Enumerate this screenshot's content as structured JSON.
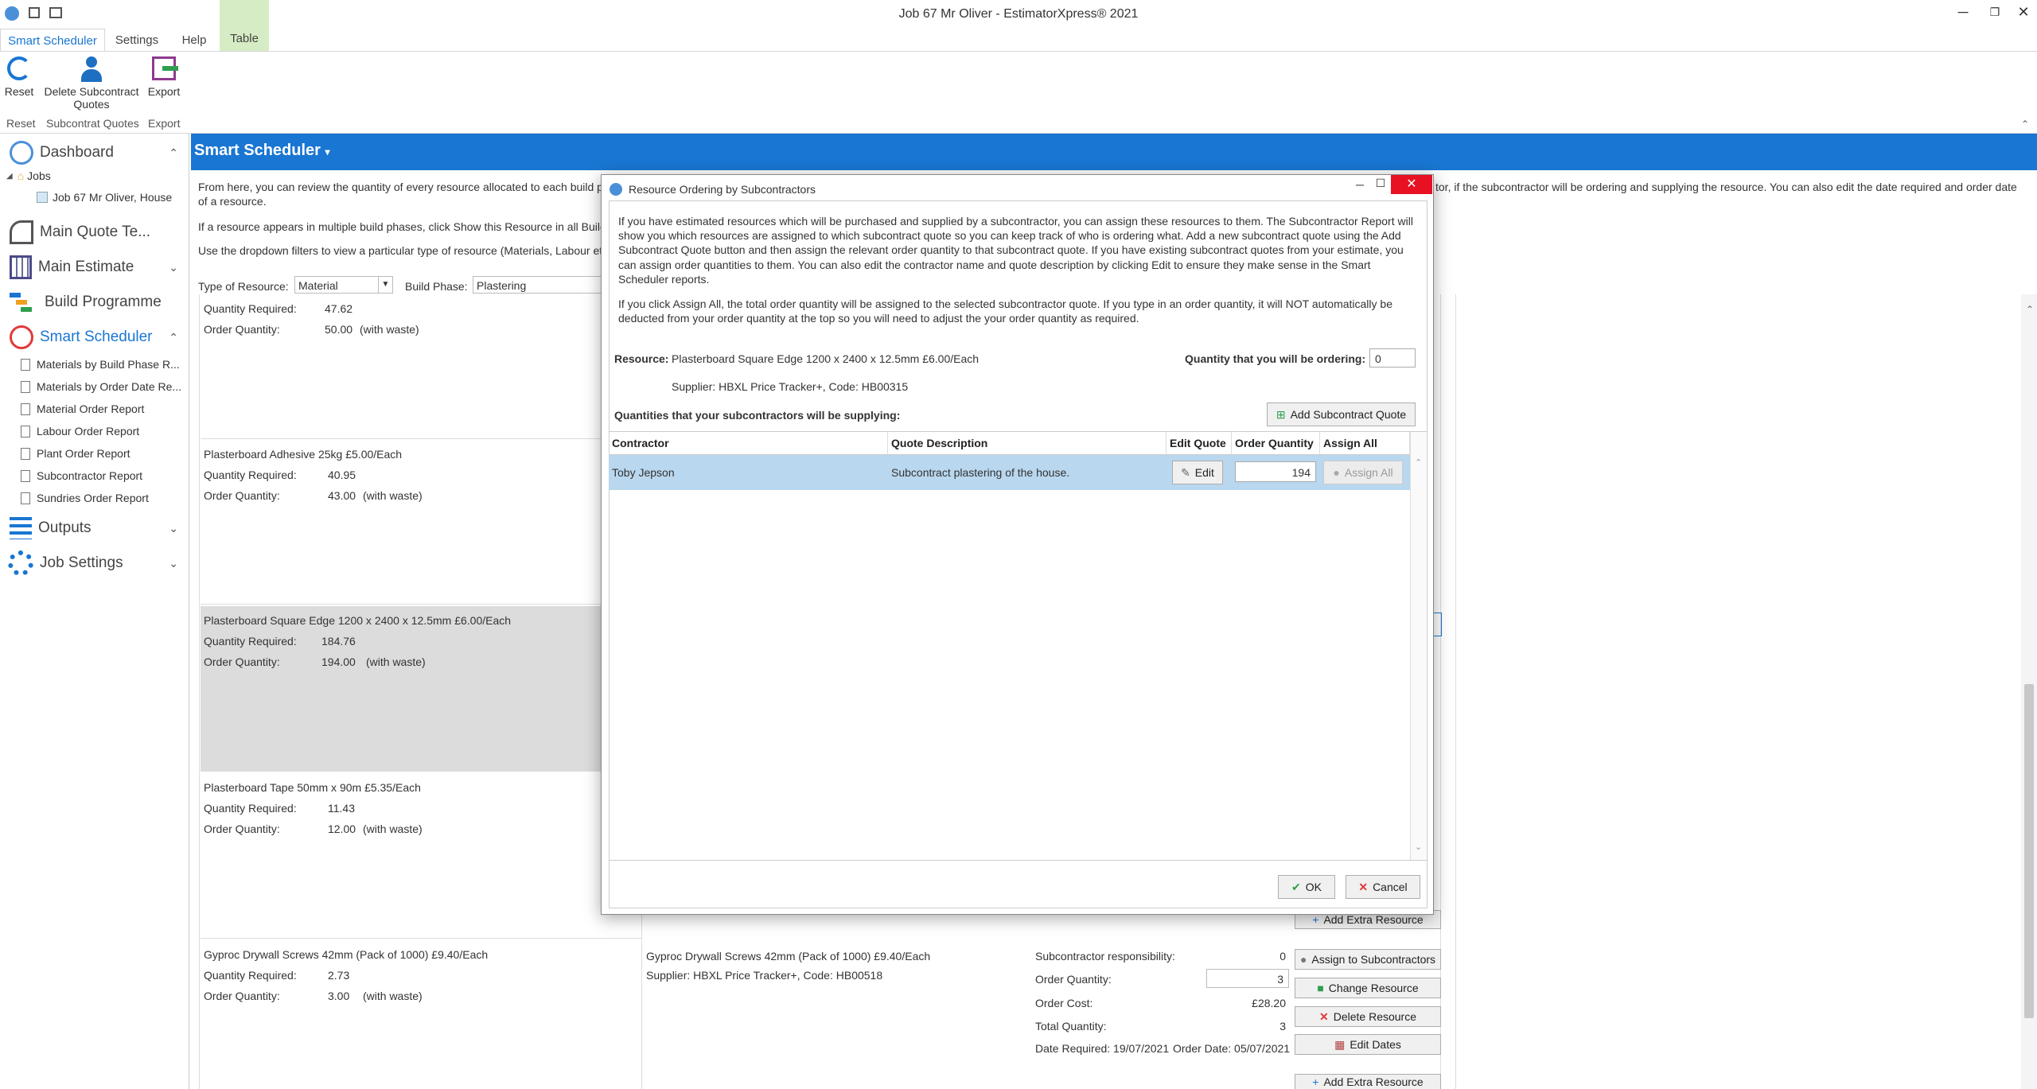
{
  "window": {
    "title": "Job 67 Mr Oliver - EstimatorXpress® 2021"
  },
  "ribbon_tabs": [
    "Smart Scheduler",
    "Settings",
    "Help",
    "Table"
  ],
  "ribbon": {
    "reset_label": "Reset",
    "delete_label_1": "Delete Subcontract",
    "delete_label_2": "Quotes",
    "export_label": "Export",
    "group_reset": "Reset",
    "group_subcontract": "Subcontrat Quotes",
    "group_export": "Export"
  },
  "nav": {
    "dashboard": "Dashboard",
    "jobs": "Jobs",
    "job_item": "Job 67 Mr Oliver, House",
    "main_quote": "Main Quote Te...",
    "main_estimate": "Main Estimate",
    "build_programme": "Build Programme",
    "smart_scheduler": "Smart Scheduler",
    "sub_items": [
      "Materials by Build Phase R...",
      "Materials by Order Date Re...",
      "Material Order Report",
      "Labour Order Report",
      "Plant Order Report",
      "Subcontractor Report",
      "Sundries Order Report"
    ],
    "outputs": "Outputs",
    "job_settings": "Job Settings"
  },
  "main": {
    "title": "Smart Scheduler",
    "intro_1a": "From here, you can review the quantity of every resource allocated to each build p",
    "intro_1b": "tor, if the subcontractor will be ordering and supplying the resource. You can also edit the date required and order date",
    "intro_1c": "of a resource.",
    "intro_2": "If a resource appears in multiple build phases, click Show this Resource in all Build",
    "intro_3": "Use the dropdown filters to view a particular type of resource (Materials, Labour et",
    "type_label": "Type of Resource:",
    "type_value": "Material",
    "phase_label": "Build Phase:",
    "phase_value": "Plastering"
  },
  "cards": [
    {
      "name": "",
      "qty_label": "Quantity Required:",
      "qty": "47.62",
      "order_label": "Order Quantity:",
      "order": "50.00",
      "waste": "(with waste)"
    },
    {
      "name": "Plasterboard Adhesive 25kg £5.00/Each",
      "qty_label": "Quantity Required:",
      "qty": "40.95",
      "order_label": "Order Quantity:",
      "order": "43.00",
      "waste": "(with waste)"
    },
    {
      "name": "Plasterboard Square Edge 1200 x 2400 x 12.5mm £6.00/Each",
      "qty_label": "Quantity Required:",
      "qty": "184.76",
      "order_label": "Order Quantity:",
      "order": "194.00",
      "waste": "(with waste)"
    },
    {
      "name": "Plasterboard Tape 50mm x 90m £5.35/Each",
      "qty_label": "Quantity Required:",
      "qty": "11.43",
      "order_label": "Order Quantity:",
      "order": "12.00",
      "waste": "(with waste)"
    },
    {
      "name": "Gyproc Drywall Screws 42mm (Pack of 1000) £9.40/Each",
      "qty_label": "Quantity Required:",
      "qty": "2.73",
      "order_label": "Order Quantity:",
      "order": "3.00",
      "waste": "(with waste)"
    }
  ],
  "detail": {
    "name": "Gyproc Drywall Screws 42mm (Pack of 1000) £9.40/Each",
    "supplier": "Supplier: HBXL Price Tracker+, Code: HB00518",
    "sub_resp_label": "Subcontractor responsibility:",
    "sub_resp": "0",
    "order_qty_label": "Order Quantity:",
    "order_qty": "3",
    "order_cost_label": "Order Cost:",
    "order_cost": "£28.20",
    "total_qty_label": "Total Quantity:",
    "total_qty": "3",
    "date_required": "Date Required: 19/07/2021",
    "order_date": "Order Date: 05/07/2021",
    "btn_add_extra": "Add Extra Resource",
    "btn_assign": "Assign to Subcontractors",
    "btn_change": "Change Resource",
    "btn_delete": "Delete Resource",
    "btn_edit_dates": "Edit Dates"
  },
  "dialog": {
    "title": "Resource Ordering by Subcontractors",
    "info_lines_1": [
      "If you have estimated resources which will be purchased and supplied by a subcontractor, you can assign these resources to them.  The Subcontractor Report will",
      "show you which resources are assigned to which subcontract quote so you can keep track of who is ordering what.  Add a new subcontract quote using the Add",
      "Subcontract Quote button and then assign the relevant order quantity to that subcontract quote.  If you have existing subcontract quotes from your estimate, you",
      "can assign order quantities to them.  You can also edit the contractor name and quote description by clicking Edit to ensure they make sense in the Smart",
      "Scheduler reports."
    ],
    "info_lines_2": [
      "If you click Assign All, the total order quantity will be assigned to the selected subcontractor quote.  If you type in an order quantity, it will NOT automatically be",
      "deducted from your order quantity at the top so you will need to adjust the your order quantity as required."
    ],
    "resource_label": "Resource:",
    "resource_value": "Plasterboard Square Edge 1200 x 2400 x 12.5mm £6.00/Each",
    "supplier": "Supplier: HBXL Price Tracker+, Code: HB00315",
    "ordering_label": "Quantity that you will be ordering:",
    "ordering_value": "0",
    "quantities_label": "Quantities that your subcontractors will be supplying:",
    "add_quote_btn": "Add Subcontract Quote",
    "columns": [
      "Contractor",
      "Quote Description",
      "Edit Quote",
      "Order Quantity",
      "Assign All"
    ],
    "rows": [
      {
        "contractor": "Toby Jepson",
        "description": "Subcontract plastering of the house.",
        "edit": "Edit",
        "quantity": "194",
        "assign": "Assign All"
      }
    ],
    "ok": "OK",
    "cancel": "Cancel"
  }
}
